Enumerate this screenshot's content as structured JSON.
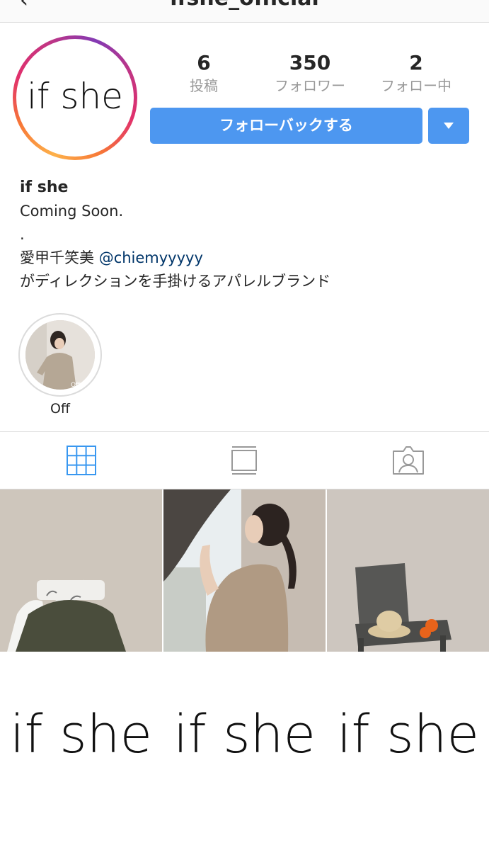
{
  "header": {
    "back_glyph": "‹",
    "title": "ifshe_official"
  },
  "profile": {
    "avatar_text": "if she",
    "stats": [
      {
        "value": "6",
        "label": "投稿"
      },
      {
        "value": "350",
        "label": "フォロワー"
      },
      {
        "value": "2",
        "label": "フォロー中"
      }
    ],
    "follow_button": "フォローバックする",
    "accent_color": "#4d97f0"
  },
  "bio": {
    "name": "if she",
    "line1": "Coming Soon.",
    "line2": ".",
    "line3_prefix": "愛甲千笑美 ",
    "line3_mention": "@chiemyyyyy",
    "line4": "がディレクションを手掛けるアパレルブランド"
  },
  "highlights": [
    {
      "label": "Off"
    }
  ],
  "tabs": [
    {
      "icon": "grid-icon",
      "active": true
    },
    {
      "icon": "feed-icon",
      "active": false
    },
    {
      "icon": "tagged-icon",
      "active": false
    }
  ],
  "posts": [
    {
      "kind": "photo",
      "subject": "clothes on white chair"
    },
    {
      "kind": "photo",
      "subject": "woman by window"
    },
    {
      "kind": "photo",
      "subject": "straw hat on chair with oranges"
    },
    {
      "kind": "logo",
      "text": "if she"
    },
    {
      "kind": "logo",
      "text": "if she"
    },
    {
      "kind": "logo",
      "text": "if she"
    }
  ]
}
